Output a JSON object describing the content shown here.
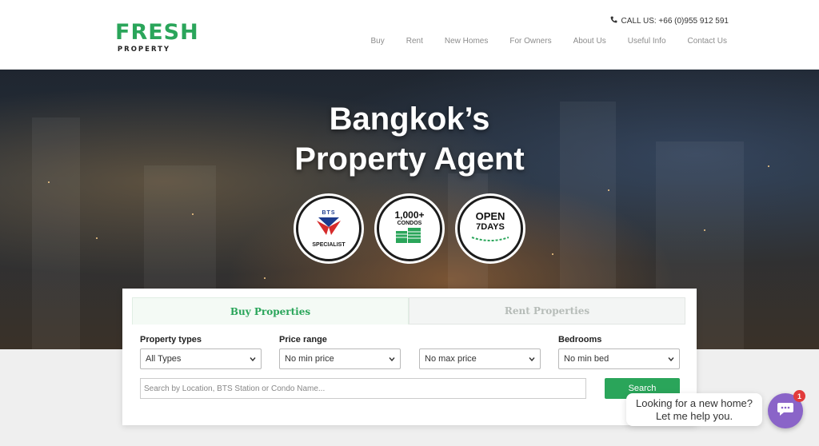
{
  "header": {
    "logo_top": "FRESH",
    "logo_bottom": "PROPERTY",
    "call_label": "CALL US: +66 (0)955 912 591",
    "nav": [
      "Buy",
      "Rent",
      "New Homes",
      "For Owners",
      "About Us",
      "Useful Info",
      "Contact Us"
    ]
  },
  "hero": {
    "title_line1": "Bangkok’s",
    "title_line2": "Property Agent",
    "badges": {
      "bts_top": "BTS",
      "bts_sub": "SPECIALIST",
      "condos_num": "1,000+",
      "condos_txt": "CONDOS",
      "open_txt": "OPEN",
      "open_sub": "7DAYS"
    }
  },
  "search": {
    "tabs": [
      "Buy Properties",
      "Rent Properties"
    ],
    "active_tab": "Buy Properties",
    "labels": {
      "property_types": "Property types",
      "price_range": "Price range",
      "bedrooms": "Bedrooms"
    },
    "values": {
      "property_types": "All Types",
      "min_price": "No min price",
      "max_price": "No max price",
      "bedrooms": "No min bed"
    },
    "placeholder": "Search by Location, BTS Station or Condo Name...",
    "button": "Search"
  },
  "chat": {
    "line1": "Looking for a new home?",
    "line2": "Let me help you.",
    "count": "1"
  },
  "colors": {
    "brand_green": "#2aa55a",
    "chat_purple": "#8a64c8",
    "badge_red": "#e23b3b"
  },
  "icons": [
    "phone-icon",
    "chevron-down-icon",
    "chat-icon"
  ]
}
